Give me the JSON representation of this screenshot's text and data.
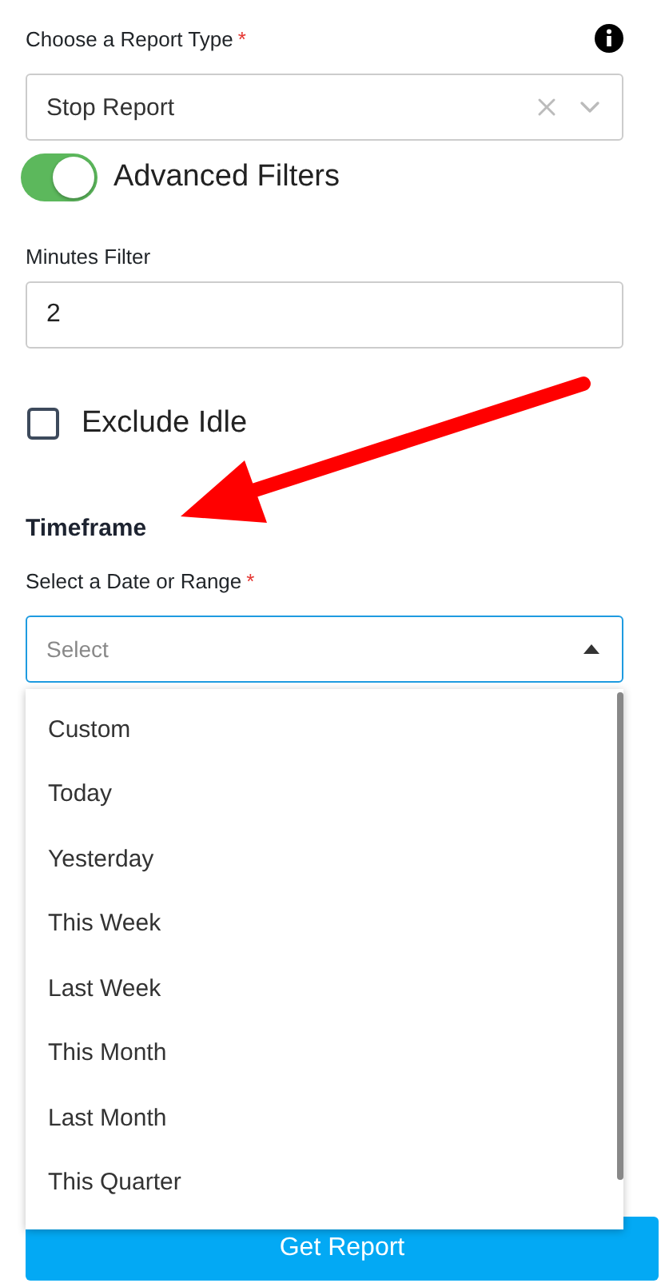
{
  "report_type": {
    "label": "Choose a Report Type",
    "required_mark": "*",
    "value": "Stop Report"
  },
  "advanced_filters": {
    "label": "Advanced Filters",
    "on": true
  },
  "minutes_filter": {
    "label": "Minutes Filter",
    "value": "2"
  },
  "exclude_idle": {
    "label": "Exclude Idle",
    "checked": false
  },
  "timeframe": {
    "heading": "Timeframe",
    "label": "Select a Date or Range",
    "required_mark": "*",
    "placeholder": "Select",
    "expanded": true,
    "options": [
      {
        "label": "Custom",
        "selected": false
      },
      {
        "label": "Today",
        "selected": false
      },
      {
        "label": "Yesterday",
        "selected": false
      },
      {
        "label": "This Week",
        "selected": false
      },
      {
        "label": "Last Week",
        "selected": false
      },
      {
        "label": "This Month",
        "selected": false
      },
      {
        "label": "Last Month",
        "selected": false
      },
      {
        "label": "This Quarter",
        "selected": false
      }
    ]
  },
  "submit": "Get Report"
}
